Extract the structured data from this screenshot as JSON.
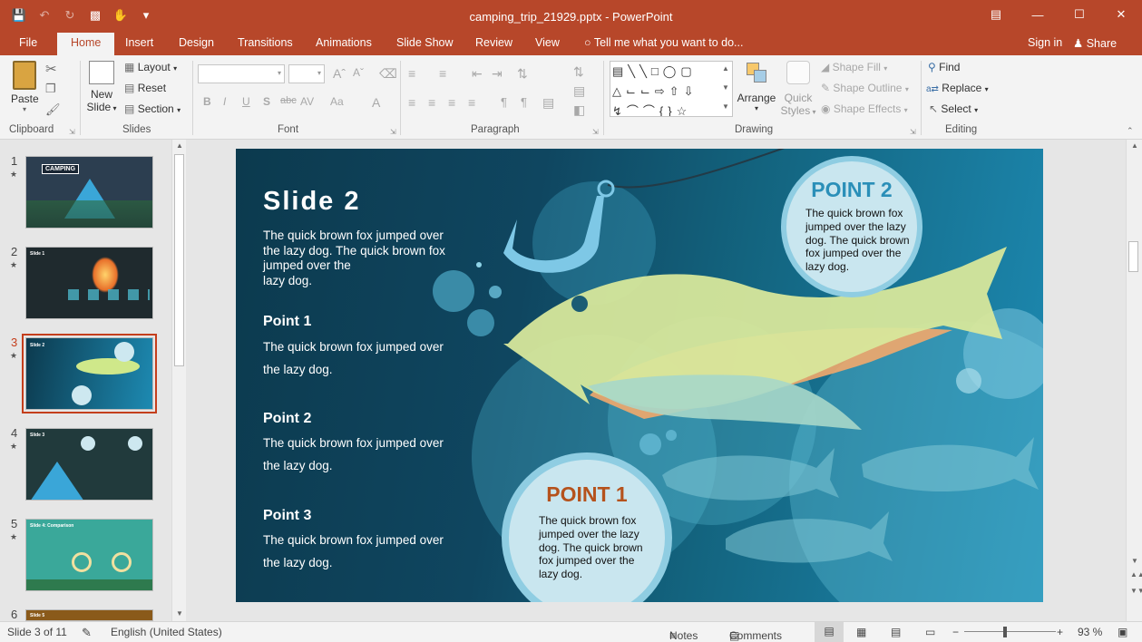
{
  "window": {
    "title": "camping_trip_21929.pptx - PowerPoint",
    "min_icon": "minimize-icon",
    "max_icon": "maximize-icon",
    "close_icon": "close-icon"
  },
  "tabs": [
    "File",
    "Home",
    "Insert",
    "Design",
    "Transitions",
    "Animations",
    "Slide Show",
    "Review",
    "View"
  ],
  "active_tab": "Home",
  "tell_me": "Tell me what you want to do...",
  "sign_in": "Sign in",
  "share": "Share",
  "ribbon": {
    "clipboard": {
      "label": "Clipboard",
      "paste": "Paste"
    },
    "slides": {
      "label": "Slides",
      "new_slide_1": "New",
      "new_slide_2": "Slide",
      "layout": "Layout",
      "reset": "Reset",
      "section": "Section"
    },
    "font": {
      "label": "Font",
      "bold": "B",
      "italic": "I",
      "underline": "U",
      "shadow": "S",
      "strike": "abc",
      "spacing": "AV",
      "case": "Aa",
      "color": "A"
    },
    "paragraph": {
      "label": "Paragraph"
    },
    "drawing": {
      "label": "Drawing",
      "arrange": "Arrange",
      "quick_styles_1": "Quick",
      "quick_styles_2": "Styles",
      "shape_fill": "Shape Fill",
      "shape_outline": "Shape Outline",
      "shape_effects": "Shape Effects"
    },
    "editing": {
      "label": "Editing",
      "find": "Find",
      "replace": "Replace",
      "select": "Select"
    }
  },
  "thumbnails": [
    {
      "num": "1",
      "title": "CAMPING",
      "bg": "#2c3e50"
    },
    {
      "num": "2",
      "title": "Slide 1",
      "bg": "#1f2a2e"
    },
    {
      "num": "3",
      "title": "Slide 2",
      "bg": "#0f4660"
    },
    {
      "num": "4",
      "title": "Slide 3",
      "bg": "#213a3c"
    },
    {
      "num": "5",
      "title": "Slide 4: Comparison",
      "bg": "#3aa89a"
    },
    {
      "num": "6",
      "title": "Slide 5",
      "bg": "#8a5a1a"
    }
  ],
  "slide": {
    "title": "Slide 2",
    "intro_1": "The quick brown fox jumped over the lazy dog. The quick brown fox jumped over the",
    "intro_2": "lazy dog.",
    "points": [
      {
        "heading": "Point 1",
        "body": "The quick brown fox jumped over the lazy dog."
      },
      {
        "heading": "Point 2",
        "body": "The quick brown fox jumped over the lazy dog."
      },
      {
        "heading": "Point 3",
        "body": "The quick brown fox jumped over the lazy dog."
      }
    ],
    "bubble_top": {
      "heading": "POINT 2",
      "body": "The quick brown fox jumped over the lazy dog. The quick brown fox jumped over the lazy dog."
    },
    "bubble_bottom": {
      "heading": "POINT 1",
      "body": "The quick brown fox jumped over the lazy dog. The quick brown fox jumped over the lazy dog."
    }
  },
  "status": {
    "slide_of": "Slide 3 of 11",
    "language": "English (United States)",
    "notes": "Notes",
    "comments": "Comments",
    "zoom": "93 %"
  }
}
